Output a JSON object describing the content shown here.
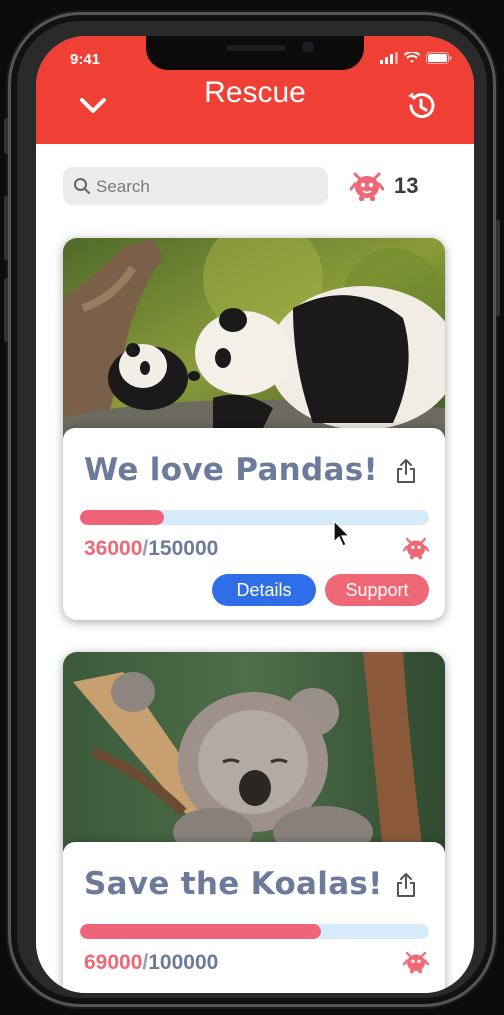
{
  "status_bar": {
    "time": "9:41"
  },
  "app_bar": {
    "title": "Rescue",
    "back_icon": "chevron-down-icon",
    "history_icon": "history-icon",
    "color": "#f04035"
  },
  "search": {
    "placeholder": "Search"
  },
  "monster_count": {
    "value": "13",
    "icon": "monster-icon"
  },
  "cards": [
    {
      "title": "We love Pandas!",
      "raised": "36000",
      "separator": "/",
      "goal": "150000",
      "progress": 0.24,
      "details_label": "Details",
      "support_label": "Support",
      "photo": "pandas"
    },
    {
      "title": "Save the Koalas!",
      "raised": "69000",
      "separator": "/",
      "goal": "100000",
      "progress": 0.69,
      "photo": "koala"
    }
  ],
  "colors": {
    "accent": "#f04035",
    "raised": "#ef6878",
    "title": "#6d7b9a",
    "details": "#2f6ee8",
    "track": "#d6ebfa"
  }
}
